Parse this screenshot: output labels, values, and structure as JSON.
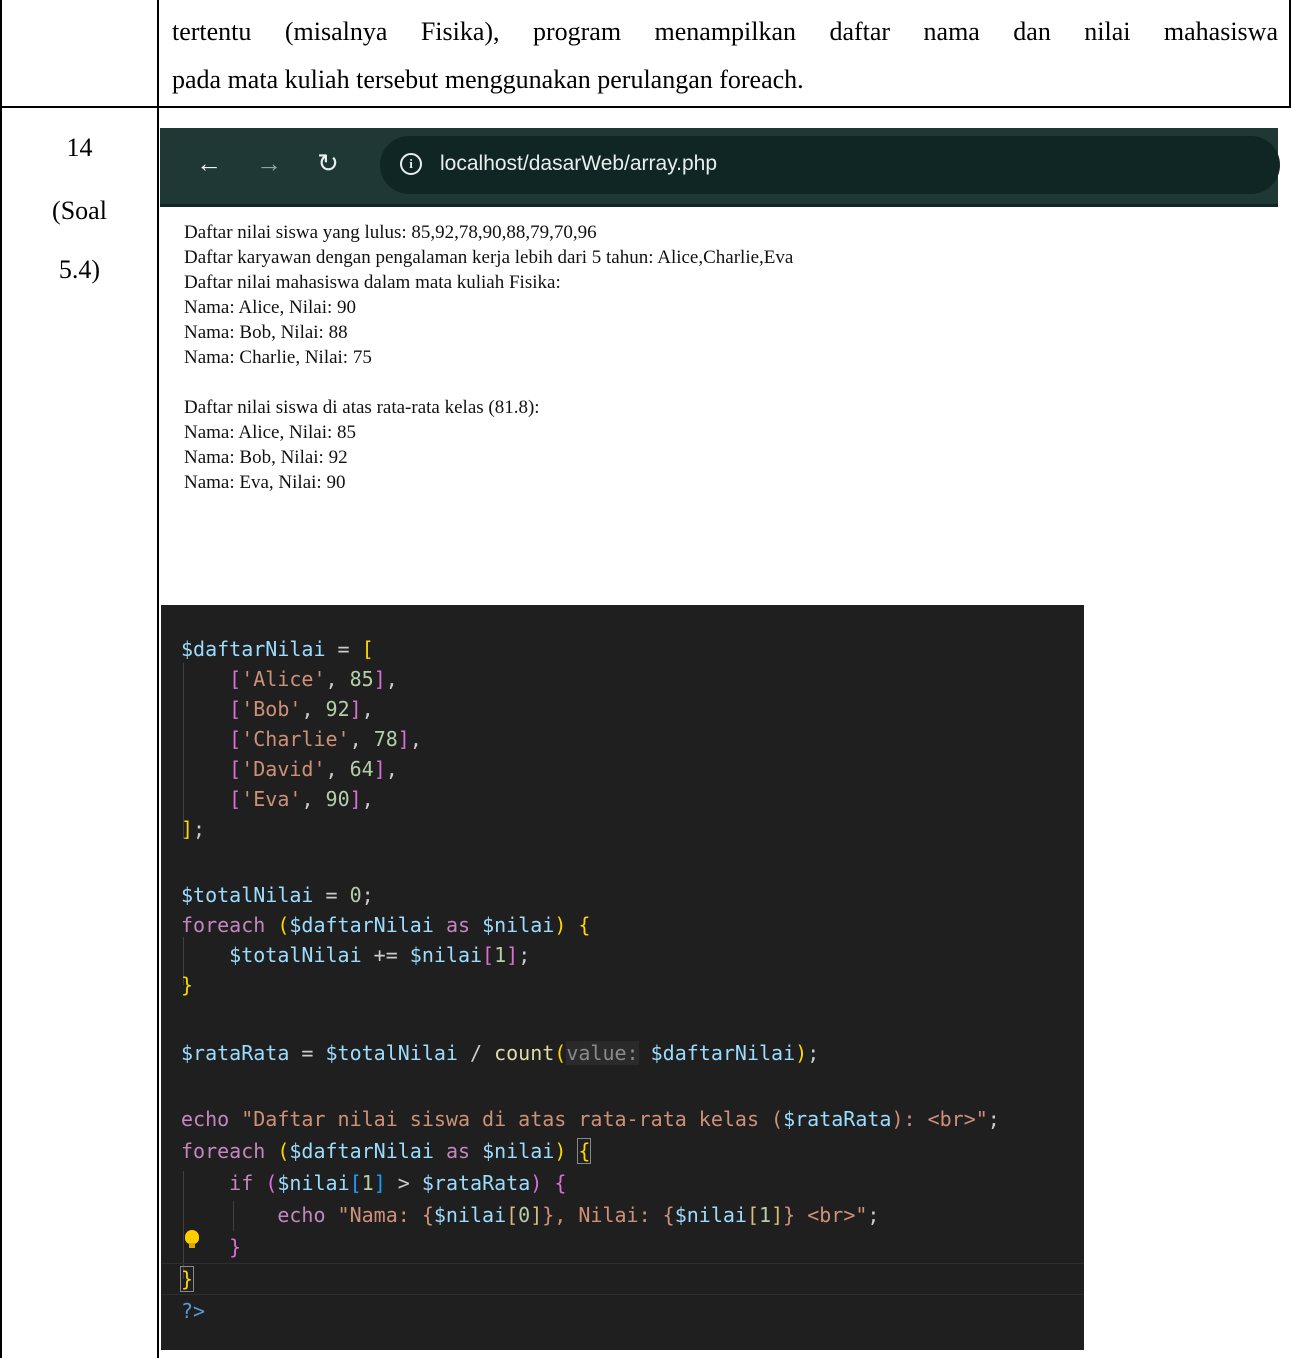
{
  "intro": {
    "line1": "tertentu (misalnya Fisika), program menampilkan daftar nama dan nilai mahasiswa",
    "line2": "pada mata kuliah tersebut menggunakan perulangan foreach."
  },
  "row": {
    "number": "14",
    "label_line1": "(Soal",
    "label_line2": "5.4)"
  },
  "browser": {
    "url": "localhost/dasarWeb/array.php",
    "icons": [
      "back-arrow-icon",
      "forward-arrow-icon",
      "reload-icon",
      "info-icon"
    ]
  },
  "output": {
    "lines": [
      "Daftar nilai siswa yang lulus: 85,92,78,90,88,79,70,96",
      "Daftar karyawan dengan pengalaman kerja lebih dari 5 tahun: Alice,Charlie,Eva",
      "Daftar nilai mahasiswa dalam mata kuliah Fisika:",
      "Nama: Alice, Nilai: 90",
      "Nama: Bob, Nilai: 88",
      "Nama: Charlie, Nilai: 75",
      "Daftar nilai siswa di atas rata-rata kelas (81.8):",
      "Nama: Alice, Nilai: 85",
      "Nama: Bob, Nilai: 92",
      "Nama: Eva, Nilai: 90"
    ]
  },
  "code": {
    "var_daftar": "$daftarNilai",
    "var_total": "$totalNilai",
    "var_nilai": "$nilai",
    "var_rata": "$rataRata",
    "students": [
      {
        "name": "'Alice'",
        "score": "85"
      },
      {
        "name": "'Bob'",
        "score": "92"
      },
      {
        "name": "'Charlie'",
        "score": "78"
      },
      {
        "name": "'David'",
        "score": "64"
      },
      {
        "name": "'Eva'",
        "score": "90"
      }
    ],
    "zero": "0",
    "kw_foreach": "foreach",
    "kw_as": "as",
    "kw_if": "if",
    "kw_echo": "echo",
    "fn_count": "count",
    "hint_value": "value:",
    "idx0": "0",
    "idx1": "1",
    "echo1_a": "\"Daftar nilai siswa di atas rata-rata kelas (",
    "echo1_b": "): <br>\"",
    "echo2_a": "\"Nama: {",
    "echo2_b": "}, Nilai: {",
    "echo2_c": "} <br>\"",
    "php_close": "?>"
  }
}
